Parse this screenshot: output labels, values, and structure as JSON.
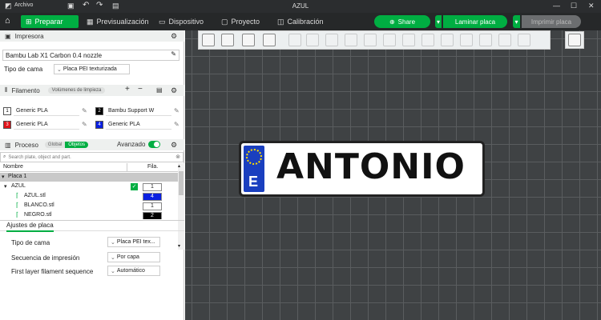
{
  "titlebar": {
    "menu": "Archivo",
    "title": "AZUL"
  },
  "tabs": [
    {
      "label": "Preparar"
    },
    {
      "label": "Previsualización"
    },
    {
      "label": "Dispositivo"
    },
    {
      "label": "Proyecto"
    },
    {
      "label": "Calibración"
    }
  ],
  "actions": {
    "share": "Share",
    "slice": "Laminar placa",
    "print": "Imprimir placa"
  },
  "printer": {
    "header": "Impresora",
    "name": "Bambu Lab X1 Carbon 0.4 nozzle",
    "bed_label": "Tipo de cama",
    "bed_value": "Placa PEI texturizada"
  },
  "filament": {
    "header": "Filamento",
    "flush_btn": "Volúmenes de limpieza",
    "items": [
      {
        "num": "1",
        "name": "Generic PLA",
        "color": "#ffffff"
      },
      {
        "num": "2",
        "name": "Bambu Support W",
        "color": "#000000"
      },
      {
        "num": "3",
        "name": "Generic PLA",
        "color": "#e0131a"
      },
      {
        "num": "4",
        "name": "Generic PLA",
        "color": "#0a1fe0"
      }
    ]
  },
  "process": {
    "header": "Proceso",
    "global": "Global",
    "objects": "Objetos",
    "advanced": "Avanzado",
    "search_placeholder": "Search plate, object and part.",
    "col_name": "Nombre",
    "col_fil": "Fila.",
    "plate": "Placa 1",
    "object": "AZUL",
    "rows": [
      {
        "name": "AZUL",
        "fil": "1"
      },
      {
        "name": "AZUL.stl",
        "fil": "4"
      },
      {
        "name": "BLANCO.stl",
        "fil": "1"
      },
      {
        "name": "NEGRO.stl",
        "fil": "2"
      }
    ]
  },
  "plate_settings": {
    "tab": "Ajustes de placa",
    "rows": [
      {
        "label": "Tipo de cama",
        "value": "Placa PEI tex..."
      },
      {
        "label": "Secuencia de impresión",
        "value": "Por capa"
      },
      {
        "label": "First layer filament sequence",
        "value": "Automático"
      }
    ]
  },
  "model": {
    "letter": "E",
    "text": "ANTONIO"
  },
  "colors": {
    "accent": "#00ae42"
  }
}
